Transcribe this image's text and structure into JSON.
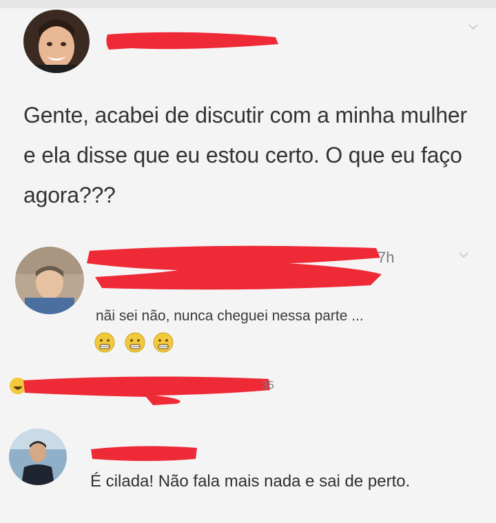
{
  "post": {
    "text": "Gente, acabei de discutir com a minha mulher e ela disse que eu estou certo. O que eu faço agora???"
  },
  "comment1": {
    "time": "7h",
    "text": "nãi sei não, nunca cheguei nessa parte ...",
    "reaction_icons": [
      "grimacing-face-icon",
      "grimacing-face-icon",
      "grimacing-face-icon"
    ]
  },
  "reactions_bar": {
    "count_suffix": "35"
  },
  "comment2": {
    "text": "É cilada! Não fala mais nada e sai de perto."
  },
  "colors": {
    "redaction": "#ee2a37",
    "background": "#f4f4f4",
    "emoji": "#f3c93c"
  }
}
